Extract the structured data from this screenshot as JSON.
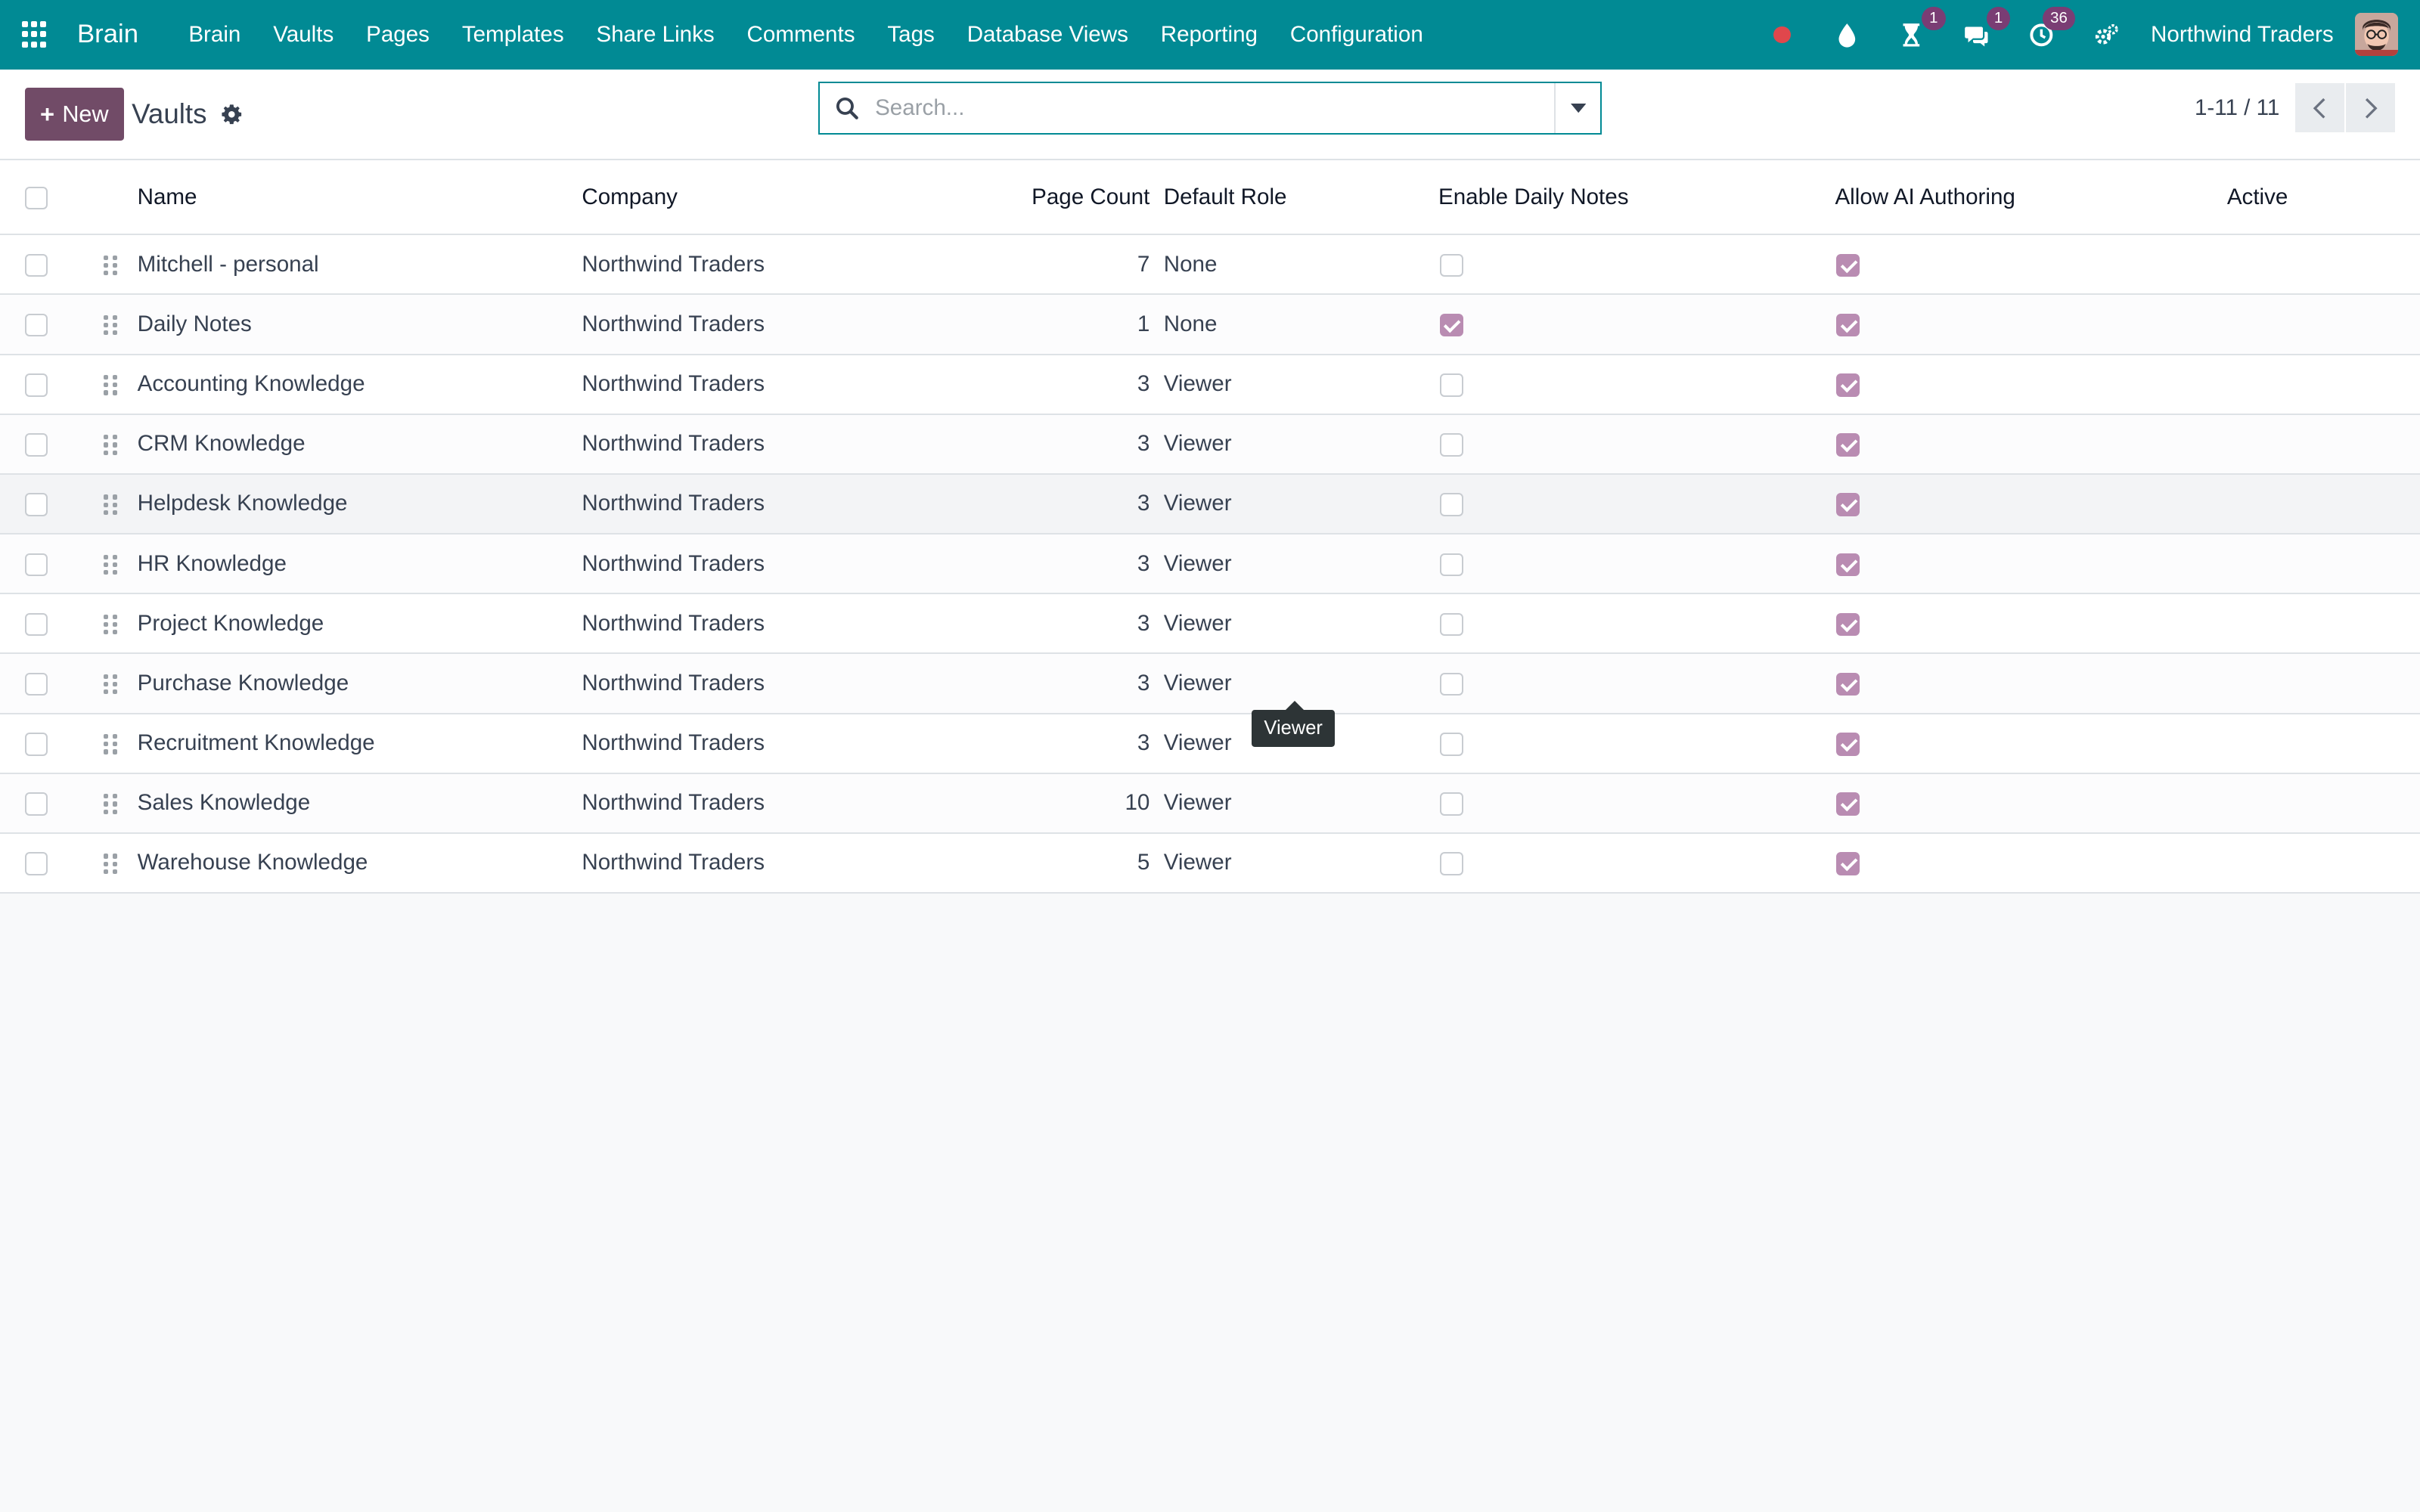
{
  "navbar": {
    "brand": "Brain",
    "menu": [
      "Brain",
      "Vaults",
      "Pages",
      "Templates",
      "Share Links",
      "Comments",
      "Tags",
      "Database Views",
      "Reporting",
      "Configuration"
    ],
    "activity_badge": "1",
    "messages_badge": "1",
    "timesheet_badge": "36",
    "company": "Northwind Traders"
  },
  "control_panel": {
    "new_label": "New",
    "title": "Vaults",
    "search_placeholder": "Search...",
    "pager": "1-11 / 11"
  },
  "table": {
    "columns": {
      "name": "Name",
      "company": "Company",
      "page_count": "Page Count",
      "default_role": "Default Role",
      "enable_daily_notes": "Enable Daily Notes",
      "allow_ai_authoring": "Allow AI Authoring",
      "active": "Active"
    },
    "rows": [
      {
        "name": "Mitchell - personal",
        "company": "Northwind Traders",
        "page_count": "7",
        "default_role": "None",
        "daily_notes": false,
        "ai_authoring": true
      },
      {
        "name": "Daily Notes",
        "company": "Northwind Traders",
        "page_count": "1",
        "default_role": "None",
        "daily_notes": true,
        "ai_authoring": true
      },
      {
        "name": "Accounting Knowledge",
        "company": "Northwind Traders",
        "page_count": "3",
        "default_role": "Viewer",
        "daily_notes": false,
        "ai_authoring": true
      },
      {
        "name": "CRM Knowledge",
        "company": "Northwind Traders",
        "page_count": "3",
        "default_role": "Viewer",
        "daily_notes": false,
        "ai_authoring": true
      },
      {
        "name": "Helpdesk Knowledge",
        "company": "Northwind Traders",
        "page_count": "3",
        "default_role": "Viewer",
        "daily_notes": false,
        "ai_authoring": true
      },
      {
        "name": "HR Knowledge",
        "company": "Northwind Traders",
        "page_count": "3",
        "default_role": "Viewer",
        "daily_notes": false,
        "ai_authoring": true
      },
      {
        "name": "Project Knowledge",
        "company": "Northwind Traders",
        "page_count": "3",
        "default_role": "Viewer",
        "daily_notes": false,
        "ai_authoring": true
      },
      {
        "name": "Purchase Knowledge",
        "company": "Northwind Traders",
        "page_count": "3",
        "default_role": "Viewer",
        "daily_notes": false,
        "ai_authoring": true
      },
      {
        "name": "Recruitment Knowledge",
        "company": "Northwind Traders",
        "page_count": "3",
        "default_role": "Viewer",
        "daily_notes": false,
        "ai_authoring": true
      },
      {
        "name": "Sales Knowledge",
        "company": "Northwind Traders",
        "page_count": "10",
        "default_role": "Viewer",
        "daily_notes": false,
        "ai_authoring": true
      },
      {
        "name": "Warehouse Knowledge",
        "company": "Northwind Traders",
        "page_count": "5",
        "default_role": "Viewer",
        "daily_notes": false,
        "ai_authoring": true
      }
    ],
    "hovered_row": 4
  },
  "tooltip": {
    "text": "Viewer"
  },
  "colors": {
    "navbar": "#018a94",
    "primary_button": "#714b67",
    "checkbox_checked": "#b98cb2",
    "record_dot": "#e0474c"
  }
}
